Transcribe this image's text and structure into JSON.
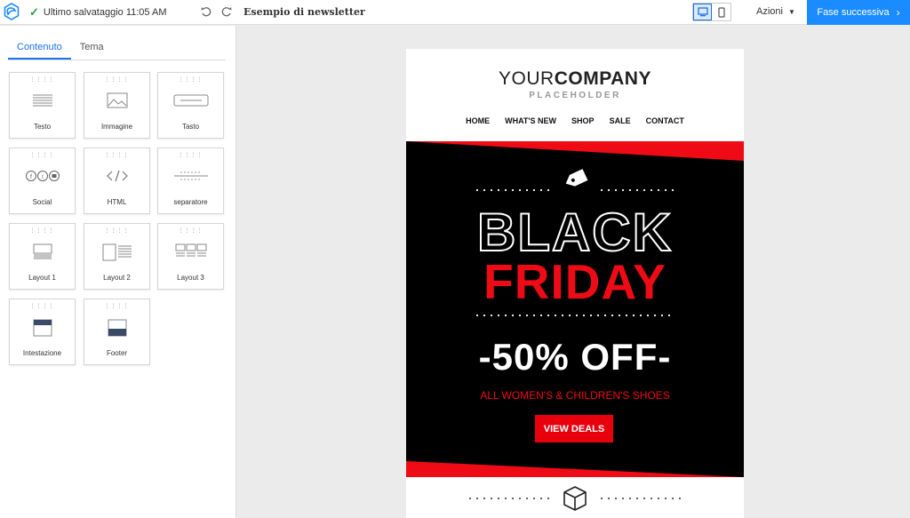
{
  "topbar": {
    "save_status": "Ultimo salvataggio 11:05 AM",
    "document_title": "Esempio di newsletter",
    "actions_label": "Azioni",
    "next_label": "Fase successiva",
    "active_view": "desktop",
    "brand_color": "#1a8cff"
  },
  "sidebar": {
    "tabs": [
      {
        "label": "Contenuto",
        "active": true
      },
      {
        "label": "Tema",
        "active": false
      }
    ],
    "blocks": [
      {
        "label": "Testo",
        "icon": "text-lines-icon"
      },
      {
        "label": "Immagine",
        "icon": "image-icon"
      },
      {
        "label": "Tasto",
        "icon": "button-icon"
      },
      {
        "label": "Social",
        "icon": "social-icon"
      },
      {
        "label": "HTML",
        "icon": "code-icon"
      },
      {
        "label": "separatore",
        "icon": "divider-icon"
      },
      {
        "label": "Layout 1",
        "icon": "layout-1-icon"
      },
      {
        "label": "Layout 2",
        "icon": "layout-2-icon"
      },
      {
        "label": "Layout 3",
        "icon": "layout-3-icon"
      },
      {
        "label": "Intestazione",
        "icon": "header-icon"
      },
      {
        "label": "Footer",
        "icon": "footer-icon"
      }
    ]
  },
  "email": {
    "brand_part1": "YOUR",
    "brand_part2": "COMPANY",
    "brand_sub": "PLACEHOLDER",
    "nav": [
      "HOME",
      "WHAT'S NEW",
      "SHOP",
      "SALE",
      "CONTACT"
    ],
    "hero_line1": "BLACK",
    "hero_line2": "FRIDAY",
    "discount": "-50% OFF-",
    "subline": "ALL WOMEN'S & CHILDREN'S SHOES",
    "cta": "VIEW DEALS",
    "accent_color": "#ef0b16"
  }
}
